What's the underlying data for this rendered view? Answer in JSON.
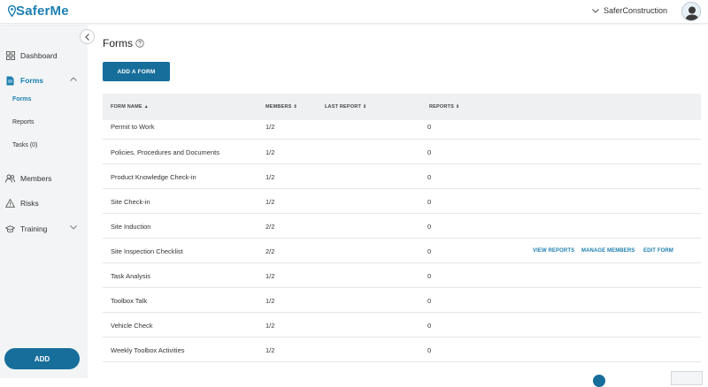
{
  "app": {
    "logo": "SaferMe",
    "organization": "SaferConstruction"
  },
  "sidebar": {
    "items": [
      {
        "label": "Dashboard"
      },
      {
        "label": "Forms"
      },
      {
        "label": "Members"
      },
      {
        "label": "Risks"
      },
      {
        "label": "Training"
      }
    ],
    "sub_items": [
      {
        "label": "Forms"
      },
      {
        "label": "Reports"
      },
      {
        "label": "Tasks (0)"
      }
    ],
    "add_label": "ADD"
  },
  "main": {
    "title": "Forms",
    "add_form_label": "ADD A FORM",
    "columns": [
      {
        "label": "FORM NAME",
        "sort": "▲"
      },
      {
        "label": "MEMBERS",
        "sort": "⇕"
      },
      {
        "label": "LAST REPORT",
        "sort": "⇕"
      },
      {
        "label": "REPORTS",
        "sort": "⇕"
      }
    ],
    "rows": [
      {
        "name": "Permit to Work",
        "members": "1/2",
        "reports": "0"
      },
      {
        "name": "Policies, Procedures and Documents",
        "members": "1/2",
        "reports": "0"
      },
      {
        "name": "Product Knowledge Check-in",
        "members": "1/2",
        "reports": "0"
      },
      {
        "name": "Site Check-in",
        "members": "1/2",
        "reports": "0"
      },
      {
        "name": "Site Induction",
        "members": "2/2",
        "reports": "0"
      },
      {
        "name": "Site Inspection Checklist",
        "members": "2/2",
        "reports": "0"
      },
      {
        "name": "Task Analysis",
        "members": "1/2",
        "reports": "0"
      },
      {
        "name": "Toolbox Talk",
        "members": "1/2",
        "reports": "0"
      },
      {
        "name": "Vehicle Check",
        "members": "1/2",
        "reports": "0"
      },
      {
        "name": "Weekly Toolbox Activities",
        "members": "1/2",
        "reports": "0"
      }
    ],
    "row_actions": {
      "view_reports": "VIEW REPORTS",
      "manage_members": "MANAGE MEMBERS",
      "edit_form": "EDIT FORM"
    }
  },
  "colors": {
    "brand": "#1d7fb0",
    "button": "#176e9b",
    "sidebar_bg": "#f2f4f5"
  }
}
